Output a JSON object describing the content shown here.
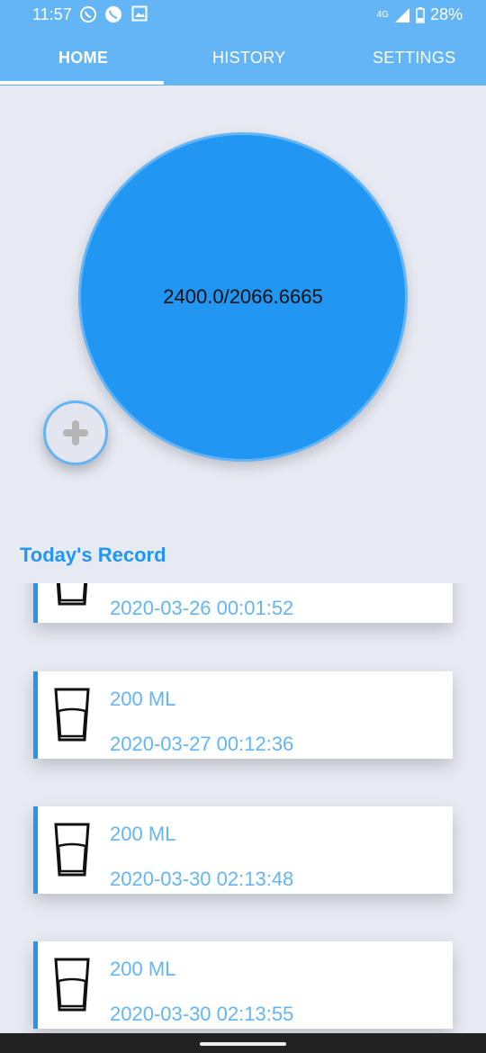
{
  "status_bar": {
    "time": "11:57",
    "battery": "28%",
    "network": "4G"
  },
  "tabs": [
    {
      "label": "HOME"
    },
    {
      "label": "HISTORY"
    },
    {
      "label": "SETTINGS"
    }
  ],
  "progress": {
    "text": "2400.0/2066.6665"
  },
  "section_title": "Today's Record",
  "records": [
    {
      "amount": "",
      "time": "2020-03-26 00:01:52"
    },
    {
      "amount": "200 ML",
      "time": "2020-03-27 00:12:36"
    },
    {
      "amount": "200 ML",
      "time": "2020-03-30 02:13:48"
    },
    {
      "amount": "200 ML",
      "time": "2020-03-30 02:13:55"
    }
  ],
  "colors": {
    "primary": "#2196f3",
    "primary_light": "#64b5f6",
    "background": "#e8eaf3"
  },
  "icons": {
    "add": "plus-icon",
    "record": "water-glass-icon"
  }
}
